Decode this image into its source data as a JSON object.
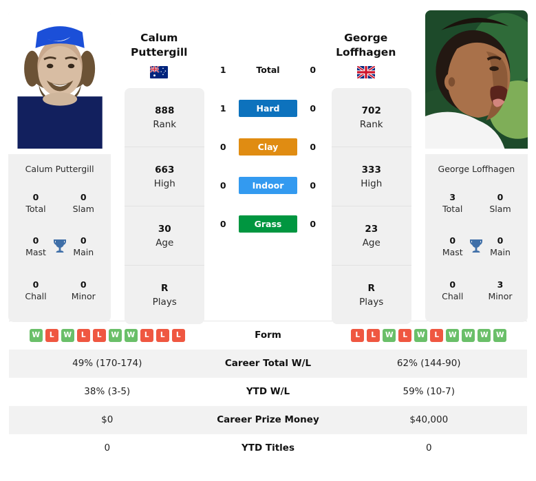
{
  "players": {
    "left": {
      "first_name": "Calum",
      "last_name": "Puttergill",
      "full_name": "Calum Puttergill",
      "country": "Australia",
      "flag_icon": "flag-australia-icon",
      "rank": "888",
      "rank_label": "Rank",
      "high": "663",
      "high_label": "High",
      "age": "30",
      "age_label": "Age",
      "plays": "R",
      "plays_label": "Plays",
      "titles": {
        "total": "0",
        "total_label": "Total",
        "slam": "0",
        "slam_label": "Slam",
        "mast": "0",
        "mast_label": "Mast",
        "main": "0",
        "main_label": "Main",
        "chall": "0",
        "chall_label": "Chall",
        "minor": "0",
        "minor_label": "Minor"
      },
      "h2h": {
        "total": "1",
        "hard": "1",
        "clay": "0",
        "indoor": "0",
        "grass": "0"
      },
      "form": [
        "W",
        "L",
        "W",
        "L",
        "L",
        "W",
        "W",
        "L",
        "L",
        "L"
      ],
      "career_wl": "49% (170-174)",
      "ytd_wl": "38% (3-5)",
      "career_prize": "$0",
      "ytd_titles": "0"
    },
    "right": {
      "first_name": "George",
      "last_name": "Loffhagen",
      "full_name": "George Loffhagen",
      "country": "United Kingdom",
      "flag_icon": "flag-uk-icon",
      "rank": "702",
      "rank_label": "Rank",
      "high": "333",
      "high_label": "High",
      "age": "23",
      "age_label": "Age",
      "plays": "R",
      "plays_label": "Plays",
      "titles": {
        "total": "3",
        "total_label": "Total",
        "slam": "0",
        "slam_label": "Slam",
        "mast": "0",
        "mast_label": "Mast",
        "main": "0",
        "main_label": "Main",
        "chall": "0",
        "chall_label": "Chall",
        "minor": "3",
        "minor_label": "Minor"
      },
      "h2h": {
        "total": "0",
        "hard": "0",
        "clay": "0",
        "indoor": "0",
        "grass": "0"
      },
      "form": [
        "L",
        "L",
        "W",
        "L",
        "W",
        "L",
        "W",
        "W",
        "W",
        "W"
      ],
      "career_wl": "62% (144-90)",
      "ytd_wl": "59% (10-7)",
      "career_prize": "$40,000",
      "ytd_titles": "0"
    }
  },
  "surfaces": [
    {
      "key": "total",
      "label": "Total",
      "color": "transparent",
      "text_color": "#111111"
    },
    {
      "key": "hard",
      "label": "Hard",
      "color": "#0d72bd",
      "text_color": "#ffffff"
    },
    {
      "key": "clay",
      "label": "Clay",
      "color": "#e08c12",
      "text_color": "#ffffff"
    },
    {
      "key": "indoor",
      "label": "Indoor",
      "color": "#339af0",
      "text_color": "#ffffff"
    },
    {
      "key": "grass",
      "label": "Grass",
      "color": "#009640",
      "text_color": "#ffffff"
    }
  ],
  "table_rows": [
    {
      "label": "Form"
    },
    {
      "label": "Career Total W/L"
    },
    {
      "label": "YTD W/L"
    },
    {
      "label": "Career Prize Money"
    },
    {
      "label": "YTD Titles"
    }
  ],
  "icons": {
    "trophy": "trophy-icon",
    "trophy_color": "#3f6fa8"
  },
  "form_colors": {
    "W": "#6abf69",
    "L": "#ef5741"
  }
}
